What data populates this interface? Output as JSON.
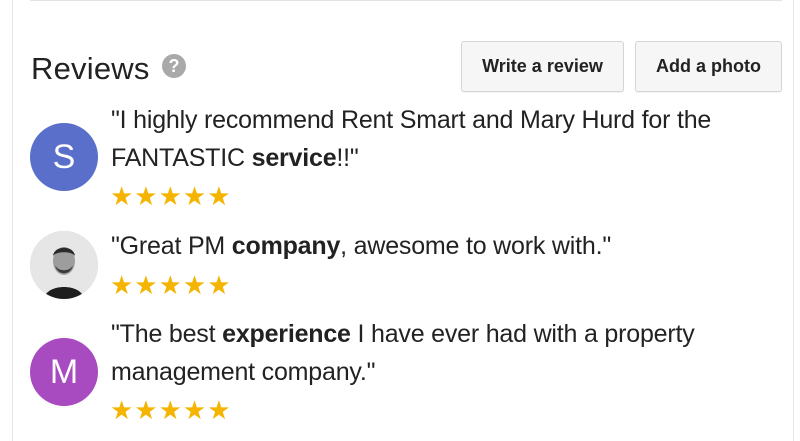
{
  "section": {
    "title": "Reviews",
    "help_icon_glyph": "?",
    "write_review_label": "Write a review",
    "add_photo_label": "Add a photo"
  },
  "reviews": [
    {
      "avatar_letter": "S",
      "avatar_color": "#5a6fc9",
      "text_part1": "\"I highly recommend Rent Smart and Mary Hurd for the FANTASTIC ",
      "text_bold": "service",
      "text_part2": "!!\"",
      "stars": "★★★★★",
      "rating": 5
    },
    {
      "avatar_letter": "",
      "avatar_icon": "user-photo",
      "text_part1": "\"Great PM ",
      "text_bold": "company",
      "text_part2": ", awesome to work with.\"",
      "stars": "★★★★★",
      "rating": 5
    },
    {
      "avatar_letter": "M",
      "avatar_color": "#a84bc1",
      "text_part1": "\"The best ",
      "text_bold": "experience",
      "text_part2": " I have ever had with a property management company.\"",
      "stars": "★★★★★",
      "rating": 5
    }
  ],
  "colors": {
    "star": "#f4b400",
    "button_bg": "#f6f6f6"
  }
}
